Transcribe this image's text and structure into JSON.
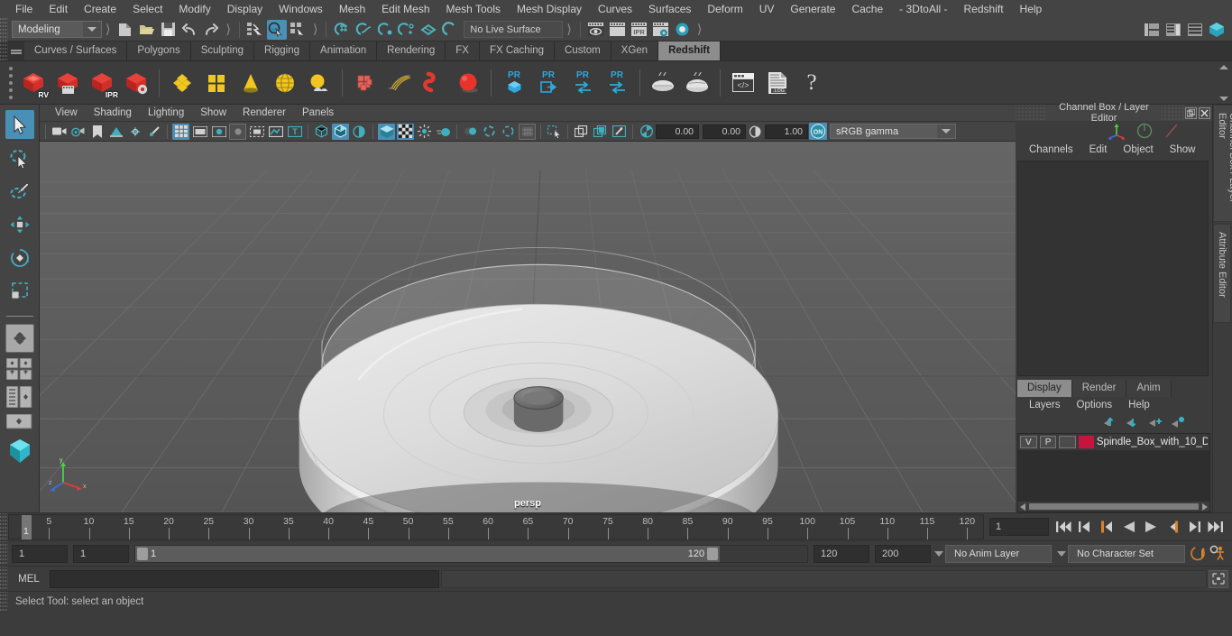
{
  "menubar": {
    "items": [
      "File",
      "Edit",
      "Create",
      "Select",
      "Modify",
      "Display",
      "Windows",
      "Mesh",
      "Edit Mesh",
      "Mesh Tools",
      "Mesh Display",
      "Curves",
      "Surfaces",
      "Deform",
      "UV",
      "Generate",
      "Cache",
      "- 3DtoAll -",
      "Redshift",
      "Help"
    ]
  },
  "statusline": {
    "menuset": "Modeling",
    "live_surface": "No Live Surface",
    "icons": {
      "new_scene": "new-scene-icon",
      "open_scene": "open-scene-icon",
      "save_scene": "save-scene-icon",
      "undo": "undo-icon",
      "redo": "redo-icon",
      "select_by_hierarchy": "select-by-hierarchy-icon",
      "select_by_object": "select-by-object-icon",
      "select_by_component": "select-by-component-icon",
      "snap_grid": "snap-to-grid-icon",
      "snap_curve": "snap-to-curve-icon",
      "snap_point": "snap-to-point-icon",
      "snap_projected": "snap-to-projected-center-icon",
      "snap_view_plane": "snap-to-view-plane-icon",
      "make_live": "make-live-icon",
      "render_view": "render-view-icon",
      "render_current": "render-current-frame-icon",
      "ipr": "ipr-render-icon",
      "render_settings": "render-settings-icon",
      "hypershade": "hypershade-icon",
      "render_globals": "render-globals-icon"
    }
  },
  "shelf": {
    "tabs": [
      "Curves / Surfaces",
      "Polygons",
      "Sculpting",
      "Rigging",
      "Animation",
      "Rendering",
      "FX",
      "FX Caching",
      "Custom",
      "XGen",
      "Redshift"
    ],
    "active_tab": "Redshift",
    "buttons": [
      {
        "name": "redshift-render-view",
        "label": "RV"
      },
      {
        "name": "redshift-render-sequence",
        "label": ""
      },
      {
        "name": "redshift-ipr",
        "label": "IPR"
      },
      {
        "name": "redshift-render-settings",
        "label": ""
      },
      {
        "name": "redshift-proxy",
        "label": ""
      },
      {
        "name": "redshift-matte",
        "label": ""
      },
      {
        "name": "redshift-cone-light",
        "label": ""
      },
      {
        "name": "redshift-dome-light",
        "label": ""
      },
      {
        "name": "redshift-sun-sky",
        "label": ""
      },
      {
        "name": "redshift-volume",
        "label": ""
      },
      {
        "name": "redshift-hair",
        "label": ""
      },
      {
        "name": "redshift-curve",
        "label": ""
      },
      {
        "name": "redshift-sphere-light",
        "label": ""
      },
      {
        "name": "redshift-pr-mesh",
        "label": "PR"
      },
      {
        "name": "redshift-pr-export",
        "label": "PR"
      },
      {
        "name": "redshift-pr-toggle",
        "label": "PR"
      },
      {
        "name": "redshift-pr-swap",
        "label": "PR"
      },
      {
        "name": "redshift-bake-1",
        "label": ""
      },
      {
        "name": "redshift-bake-2",
        "label": ""
      },
      {
        "name": "redshift-script",
        "label": ""
      },
      {
        "name": "redshift-log",
        "label": ".LOG"
      },
      {
        "name": "redshift-help",
        "label": "?"
      }
    ]
  },
  "toolbox": {
    "items": [
      {
        "name": "select-tool",
        "active": true
      },
      {
        "name": "lasso-select-tool",
        "active": false
      },
      {
        "name": "paint-select-tool",
        "active": false
      },
      {
        "name": "move-tool",
        "active": false
      },
      {
        "name": "rotate-tool",
        "active": false
      },
      {
        "name": "scale-tool",
        "active": false
      },
      {
        "name": "last-tool-used",
        "active": false
      },
      {
        "name": "layout-single-pane",
        "active": false
      },
      {
        "name": "layout-four-pane",
        "active": false
      },
      {
        "name": "layout-outliner-persp",
        "active": false
      },
      {
        "name": "layout-persp-graph",
        "active": false
      },
      {
        "name": "layout-bookmark",
        "active": false
      }
    ]
  },
  "viewport": {
    "panel_menu": [
      "View",
      "Shading",
      "Lighting",
      "Show",
      "Renderer",
      "Panels"
    ],
    "camera_label": "persp",
    "toolbar": {
      "exposure": "0.00",
      "gamma_left": "0.00",
      "gamma_value": "1.00",
      "color_space": "sRGB gamma",
      "icons": [
        "camera-icon",
        "camera-attributes-icon",
        "bookmark-icon",
        "image-plane-icon",
        "two-sided-lighting-icon",
        "shadow-icon",
        "grid-toggle-icon",
        "film-gate-icon",
        "resolution-gate-icon",
        "gate-mask-icon",
        "xray-icon",
        "xray-joints-icon",
        "texture-toggle-icon",
        "wireframe-shading-icon",
        "smooth-shading-icon",
        "smooth-shaded-textured-icon",
        "light-shading-icon",
        "shadow-shading-icon",
        "screen-space-ao-icon",
        "motion-blur-icon",
        "multisample-icon",
        "depth-peel-icon",
        "isolate-select-icon",
        "snapshot-icon",
        "panel-copy-icon",
        "grab-icon",
        "exposure-icon",
        "gamma-icon",
        "view-transform-toggle-icon"
      ]
    },
    "axis_gizmo": {
      "x": "x",
      "y": "y",
      "z": "z"
    }
  },
  "channelbox": {
    "window_title": "Channel Box / Layer Editor",
    "menu": [
      "Channels",
      "Edit",
      "Object",
      "Show"
    ],
    "window_buttons": [
      "undock-button",
      "close-button"
    ],
    "vertical_tabs": [
      "Channel Box / Layer Editor",
      "Attribute Editor"
    ]
  },
  "layer_editor": {
    "tabs": [
      "Display",
      "Render",
      "Anim"
    ],
    "active_tab": "Display",
    "menu": [
      "Layers",
      "Options",
      "Help"
    ],
    "toolbar_icons": [
      "move-layer-up-icon",
      "move-layer-down-icon",
      "new-layer-icon",
      "new-layer-from-selected-icon"
    ],
    "layers": [
      {
        "visibility": "V",
        "playback": "P",
        "state": "",
        "color": "#c8143c",
        "name": "Spindle_Box_with_10_D"
      }
    ]
  },
  "timeslider": {
    "ticks": [
      5,
      10,
      15,
      20,
      25,
      30,
      35,
      40,
      45,
      50,
      55,
      60,
      65,
      70,
      75,
      80,
      85,
      90,
      95,
      100,
      105,
      110,
      115,
      120
    ],
    "current_frame": "1",
    "frame_field": "1",
    "playback_buttons": [
      "go-to-start-icon",
      "step-back-keyframe-icon",
      "step-back-frame-icon",
      "play-backwards-icon",
      "play-forwards-icon",
      "step-forward-frame-icon",
      "step-forward-keyframe-icon",
      "go-to-end-icon"
    ]
  },
  "rangeslider": {
    "anim_start": "1",
    "range_start": "1",
    "bar_min": "1",
    "bar_max": "120",
    "range_end": "120",
    "anim_end": "200",
    "anim_layer": "No Anim Layer",
    "character_set": "No Character Set",
    "auto_keyframe_icon": "auto-keyframe-icon",
    "animation_prefs_icon": "animation-preferences-icon"
  },
  "commandline": {
    "language": "MEL",
    "input_value": "",
    "result_value": "",
    "script_editor_icon": "script-editor-icon"
  },
  "helpline": {
    "text": "Select Tool: select an object"
  },
  "colors": {
    "accent_blue": "#4a8fb5",
    "shelf_red": "#d43c32",
    "redshift_cyan": "#29b6c8",
    "layer_red": "#c8143c",
    "orange": "#d97b2e",
    "panel_bg": "#3c3c3c",
    "menu_bg": "#444444"
  }
}
